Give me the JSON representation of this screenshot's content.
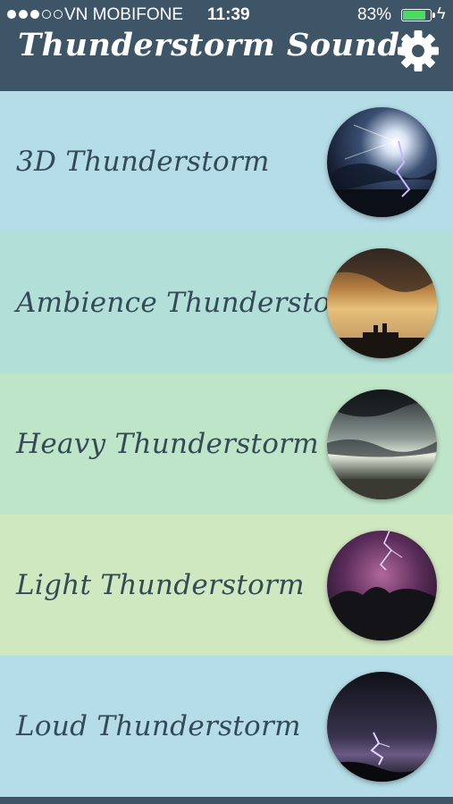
{
  "status_bar": {
    "carrier": "VN MOBIFONE",
    "time": "11:39",
    "battery_percent": "83%",
    "battery_level": 0.83,
    "signal_bars": 3,
    "signal_max": 5
  },
  "header": {
    "title": "Thunderstorm Sounds",
    "settings_icon": "gear-icon"
  },
  "items": [
    {
      "label": "3D Thunderstorm",
      "bg": "#b5dde7",
      "image": "lightning-sky"
    },
    {
      "label": "Ambience Thunderstorm",
      "bg": "#b3dfd9",
      "image": "sunset-clouds"
    },
    {
      "label": "Heavy Thunderstorm",
      "bg": "#bfe5c8",
      "image": "dark-clouds"
    },
    {
      "label": "Light Thunderstorm",
      "bg": "#d0e8c0",
      "image": "purple-lightning"
    },
    {
      "label": "Loud Thunderstorm",
      "bg": "#b5dde7",
      "image": "night-lightning"
    }
  ]
}
